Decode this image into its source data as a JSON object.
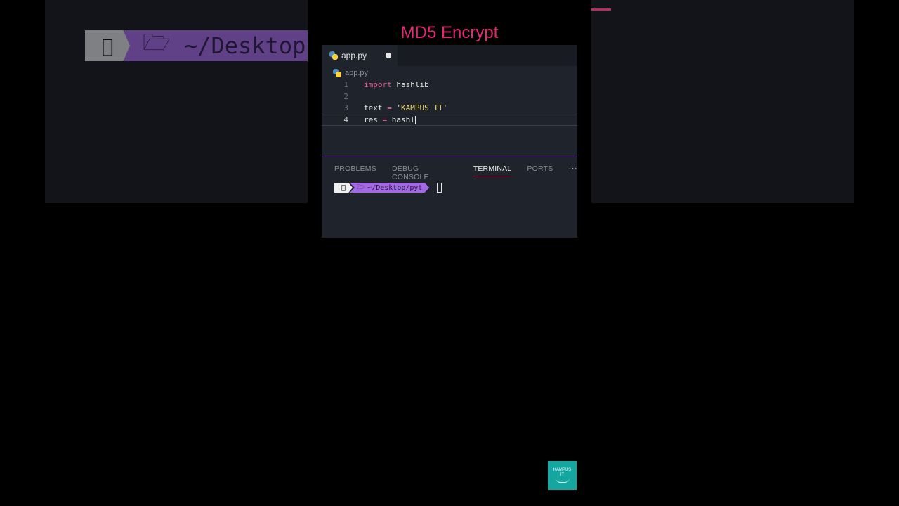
{
  "title": "MD5 Encrypt",
  "background": {
    "prompt_path": "~/Desktop"
  },
  "editor": {
    "tab": {
      "label": "app.py",
      "modified": true
    },
    "breadcrumb": "app.py",
    "lines": [
      {
        "number": "1",
        "tokens": [
          [
            "kw",
            "import"
          ],
          [
            "plain",
            " hashlib"
          ]
        ]
      },
      {
        "number": "2",
        "tokens": []
      },
      {
        "number": "3",
        "tokens": [
          [
            "plain",
            "text "
          ],
          [
            "op",
            "="
          ],
          [
            "plain",
            " "
          ],
          [
            "str",
            "'KAMPUS IT'"
          ]
        ]
      },
      {
        "number": "4",
        "tokens": [
          [
            "plain",
            "res "
          ],
          [
            "op",
            "="
          ],
          [
            "plain",
            " hashl"
          ]
        ],
        "active": true
      }
    ]
  },
  "panel": {
    "tabs": [
      "PROBLEMS",
      "DEBUG CONSOLE",
      "TERMINAL",
      "PORTS"
    ],
    "active_tab": "TERMINAL",
    "more": "···",
    "terminal": {
      "prompt_path": "~/Desktop/pyt"
    }
  },
  "logo": {
    "line1": "KAMPUS",
    "line2": "IT"
  },
  "colors": {
    "accent_pink": "#e0296f",
    "accent_purple": "#a368e3",
    "editor_bg": "#1f232b",
    "logo_teal": "#16a6a0"
  },
  "icons": {
    "tab": "python-icon",
    "breadcrumb": "python-icon",
    "prompt_os": "apple-icon",
    "prompt_dir": "folder-icon"
  }
}
